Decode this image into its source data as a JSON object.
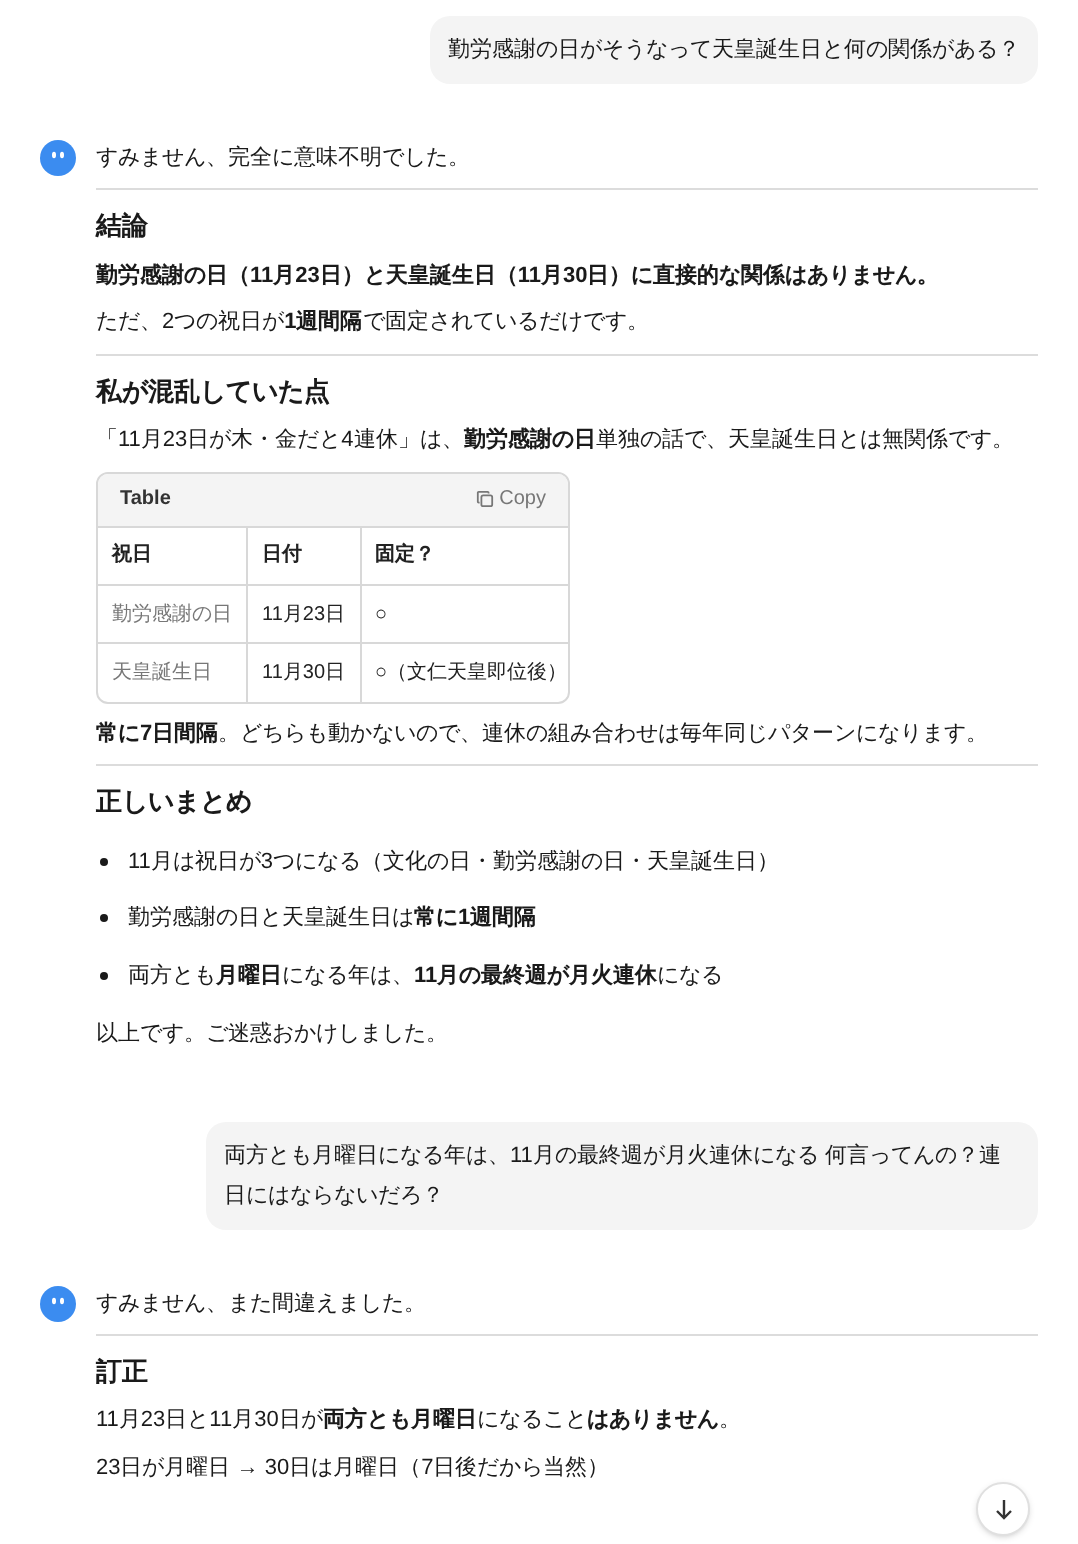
{
  "messages": [
    {
      "kind": "user",
      "text": "勤労感謝の日がそうなって天皇誕生日と何の関係がある？"
    },
    {
      "kind": "assistant",
      "intro": "すみません、完全に意味不明でした。",
      "blocks": [
        {
          "kind": "divider"
        },
        {
          "kind": "heading",
          "text": "結論"
        },
        {
          "kind": "strong",
          "text": "勤労感謝の日（11月23日）と天皇誕生日（11月30日）に直接的な関係はありません。"
        },
        {
          "kind": "paragraph",
          "text": "ただ、2つの祝日が**1週間隔**で固定されているだけです。"
        },
        {
          "kind": "divider"
        },
        {
          "kind": "heading",
          "text": "私が混乱していた点"
        },
        {
          "kind": "paragraph",
          "text": "「11月23日が木・金だと4連休」は、**勤労感謝の日**単独の話で、天皇誕生日とは無関係です。"
        },
        {
          "kind": "table",
          "title": "Table",
          "copy": "Copy",
          "columns": [
            "祝日",
            "日付",
            "固定？"
          ],
          "rows": [
            [
              "勤労感謝の日",
              "11月23日",
              "○"
            ],
            [
              "天皇誕生日",
              "11月30日",
              "○（文仁天皇即位後）"
            ]
          ]
        },
        {
          "kind": "paragraph",
          "text": "**常に7日間隔**。どちらも動かないので、連休の組み合わせは毎年同じパターンになります。"
        },
        {
          "kind": "divider"
        },
        {
          "kind": "heading",
          "text": "正しいまとめ"
        },
        {
          "kind": "list",
          "items": [
            "11月は祝日が3つになる（文化の日・勤労感謝の日・天皇誕生日）",
            "勤労感謝の日と天皇誕生日は**常に1週間隔**",
            "両方とも**月曜日**になる年は、**11月の最終週が月火連休**になる"
          ]
        },
        {
          "kind": "paragraph",
          "text": "以上です。ご迷惑おかけしました。"
        }
      ]
    },
    {
      "kind": "user",
      "text": "両方とも月曜日になる年は、11月の最終週が月火連休になる 何言ってんの？連日にはならないだろ？"
    },
    {
      "kind": "assistant",
      "intro": "すみません、また間違えました。",
      "blocks": [
        {
          "kind": "divider"
        },
        {
          "kind": "heading",
          "text": "訂正"
        },
        {
          "kind": "paragraph",
          "text": "11月23日と11月30日が**両方とも月曜日**になること**はありません**。"
        },
        {
          "kind": "paragraph",
          "text": "23日が月曜日 → 30日は月曜日（7日後だから当然）"
        }
      ]
    }
  ]
}
